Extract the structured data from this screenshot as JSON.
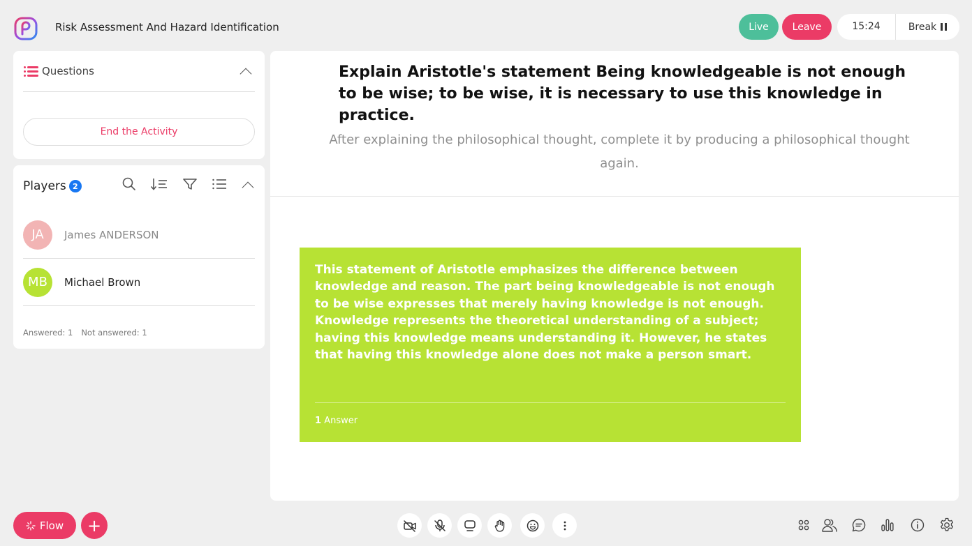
{
  "header": {
    "title": "Risk Assessment And Hazard Identification",
    "live_label": "Live",
    "leave_label": "Leave",
    "timer": "15:24",
    "break_label": "Break"
  },
  "questions_panel": {
    "title": "Questions",
    "end_button": "End the Activity"
  },
  "players_panel": {
    "title": "Players",
    "count": "2",
    "players": [
      {
        "initials": "JA",
        "name": "James ANDERSON",
        "avatar_color": "#f2b4b4",
        "name_color": "#888888"
      },
      {
        "initials": "MB",
        "name": "Michael Brown",
        "avatar_color": "#b7e234",
        "name_color": "#222222"
      }
    ],
    "answered": "Answered: 1",
    "not_answered": "Not answered: 1"
  },
  "question": {
    "title": "Explain Aristotle's statement Being knowledgeable is not enough to be wise; to be wise, it is necessary to use this knowledge in practice.",
    "subtitle": "After explaining the philosophical thought, complete it by producing a philosophical thought again."
  },
  "answer": {
    "text": "This statement of Aristotle emphasizes the difference between knowledge and reason. The part being knowledgeable is not enough to be wise expresses that merely having knowledge is not enough. Knowledge represents the theoretical understanding of a subject; having this knowledge means understanding it. However, he states that having this knowledge alone does not make a person smart.",
    "count": "1",
    "count_label": "Answer",
    "background": "#b7e234"
  },
  "footer": {
    "flow_label": "Flow",
    "plus_label": "+"
  },
  "colors": {
    "accent": "#eb3b66",
    "live": "#4dbf9a",
    "badge": "#1877f2"
  }
}
